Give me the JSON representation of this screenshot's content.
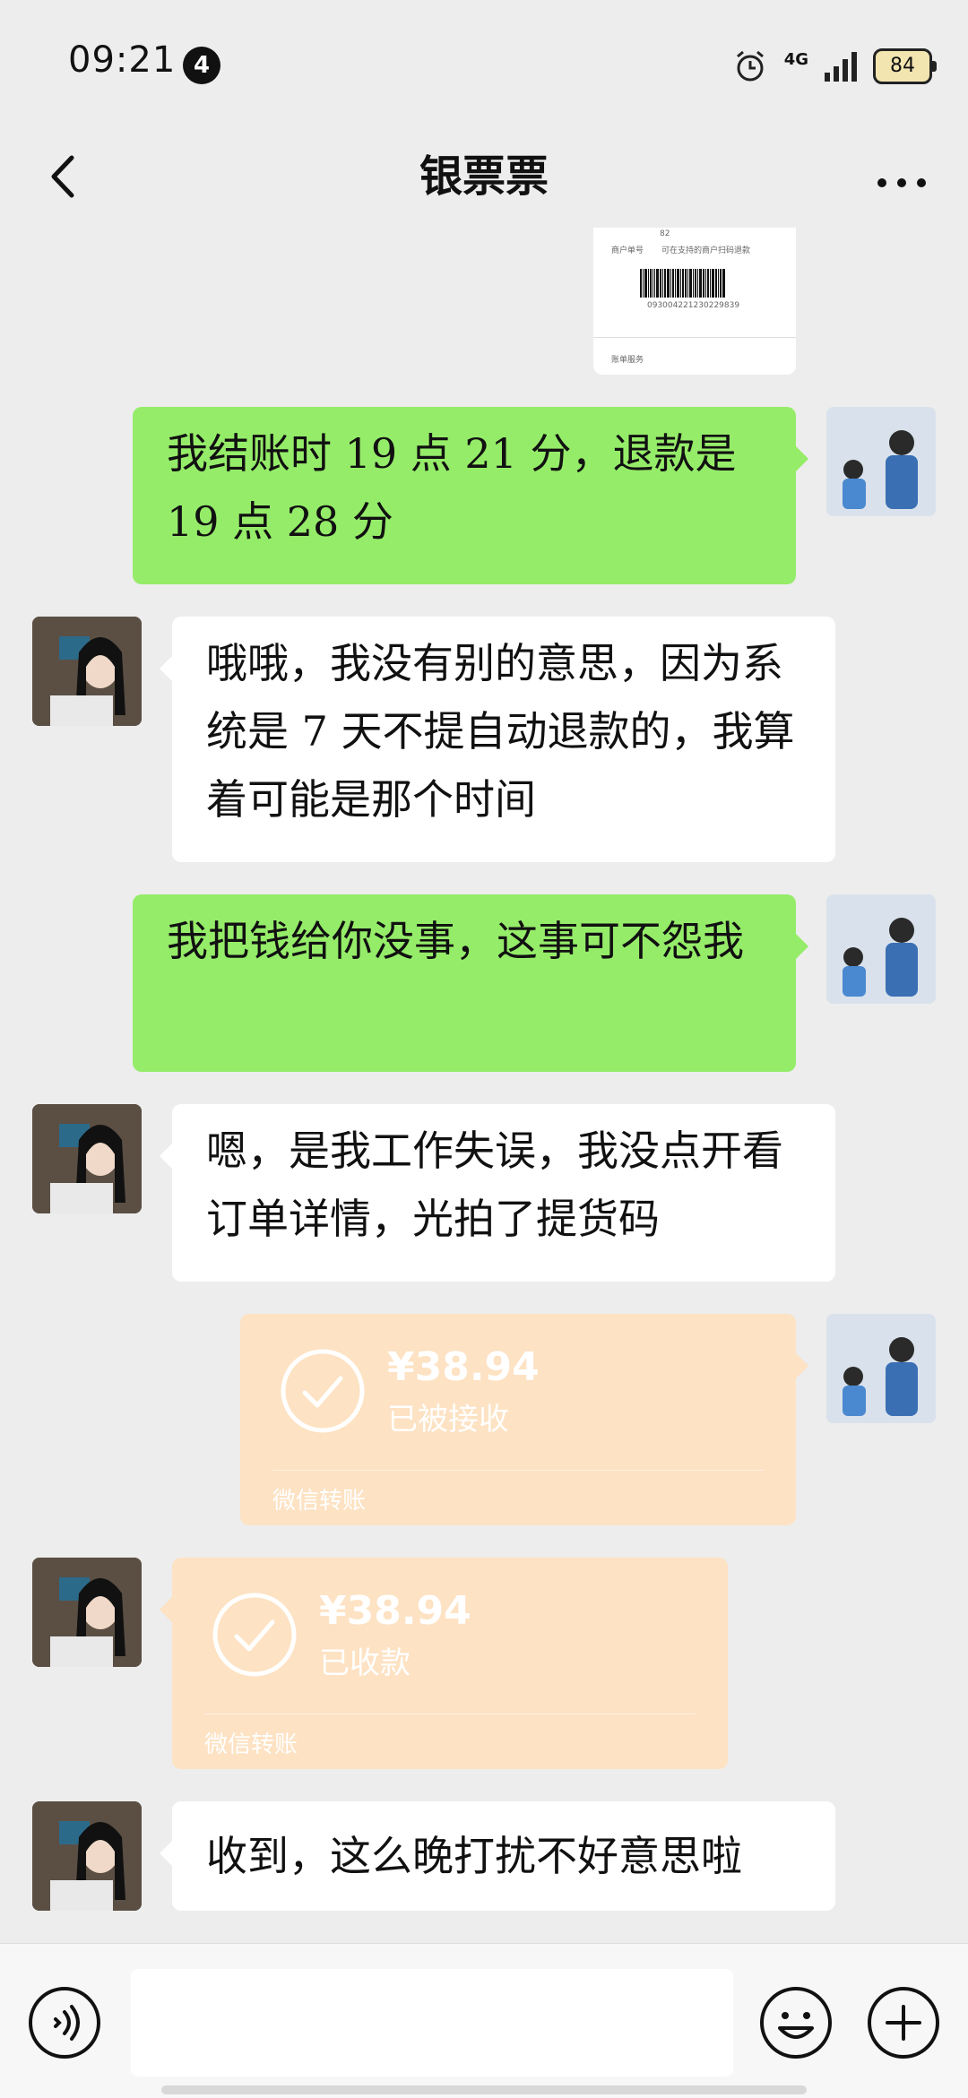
{
  "status_bar": {
    "time": "09:21",
    "notification_count": "4",
    "network": "4G",
    "battery": "84"
  },
  "nav": {
    "title": "银票票"
  },
  "image_card": {
    "line1": "82",
    "label_left": "商户单号",
    "label_right": "可在支持的商户扫码退款",
    "barcode_number": "093004221230229839",
    "footer": "账单服务"
  },
  "messages": [
    {
      "sender": "me",
      "text": "我结账时 19 点 21 分，退款是 19 点 28 分"
    },
    {
      "sender": "them",
      "text": "哦哦，我没有别的意思，因为系统是 7 天不提自动退款的，我算着可能是那个时间"
    },
    {
      "sender": "me",
      "text": "我把钱给你没事，这事可不怨我"
    },
    {
      "sender": "them",
      "text": "嗯，是我工作失误，我没点开看订单详情，光拍了提货码"
    },
    {
      "sender": "me",
      "type": "transfer",
      "amount": "¥38.94",
      "status": "已被接收",
      "footer": "微信转账"
    },
    {
      "sender": "them",
      "type": "transfer",
      "amount": "¥38.94",
      "status": "已收款",
      "footer": "微信转账"
    },
    {
      "sender": "them",
      "text": "收到，这么晚打扰不好意思啦"
    }
  ],
  "input": {
    "placeholder": ""
  },
  "icons": {
    "back": "chevron-left-icon",
    "more": "more-dots-icon",
    "voice": "voice-icon",
    "emoji": "emoji-icon",
    "plus": "plus-icon"
  },
  "colors": {
    "my_bubble": "#95ec69",
    "their_bubble": "#ffffff",
    "transfer": "#fde2c3",
    "background": "#ededed"
  }
}
